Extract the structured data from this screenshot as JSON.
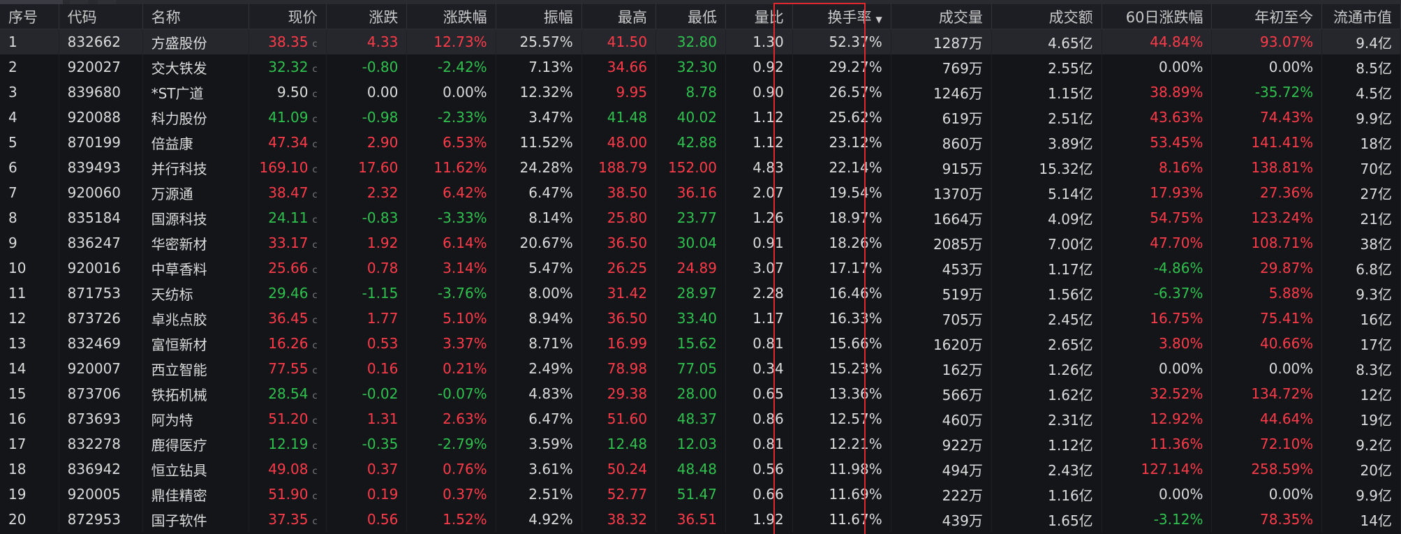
{
  "headers": {
    "seq": "序号",
    "code": "代码",
    "name": "名称",
    "price": "现价",
    "change": "涨跌",
    "pct": "涨跌幅",
    "amplitude": "振幅",
    "high": "最高",
    "low": "最低",
    "volratio": "量比",
    "turnover": "换手率",
    "volume": "成交量",
    "amount": "成交额",
    "d60": "60日涨跌幅",
    "ytd": "年初至今",
    "mcap": "流通市值"
  },
  "sort": {
    "column": "turnover",
    "direction": "desc"
  },
  "colors": {
    "up": "#ff3b4a",
    "down": "#2fc24f",
    "flat": "#dcdcdc",
    "highlight": "#e0292f"
  },
  "rows": [
    {
      "seq": "1",
      "code": "832662",
      "name": "方盛股份",
      "price": "38.35",
      "change": "4.33",
      "pct": "12.73%",
      "amplitude": "25.57%",
      "high": "41.50",
      "low": "32.80",
      "volratio": "1.30",
      "turnover": "52.37%",
      "volume": "1287万",
      "amount": "4.65亿",
      "d60": "44.84%",
      "ytd": "93.07%",
      "mcap": "9.4亿",
      "c": {
        "price": "red",
        "change": "red",
        "pct": "red",
        "high": "red",
        "low": "green",
        "d60": "red",
        "ytd": "red"
      }
    },
    {
      "seq": "2",
      "code": "920027",
      "name": "交大铁发",
      "price": "32.32",
      "change": "-0.80",
      "pct": "-2.42%",
      "amplitude": "7.13%",
      "high": "34.66",
      "low": "32.30",
      "volratio": "0.92",
      "turnover": "29.27%",
      "volume": "769万",
      "amount": "2.55亿",
      "d60": "0.00%",
      "ytd": "0.00%",
      "mcap": "8.5亿",
      "c": {
        "price": "green",
        "change": "green",
        "pct": "green",
        "high": "red",
        "low": "green",
        "d60": "white",
        "ytd": "white"
      }
    },
    {
      "seq": "3",
      "code": "839680",
      "name": "*ST广道",
      "price": "9.50",
      "change": "0.00",
      "pct": "0.00%",
      "amplitude": "12.32%",
      "high": "9.95",
      "low": "8.78",
      "volratio": "0.90",
      "turnover": "26.57%",
      "volume": "1246万",
      "amount": "1.15亿",
      "d60": "38.89%",
      "ytd": "-35.72%",
      "mcap": "4.5亿",
      "c": {
        "price": "white",
        "change": "white",
        "pct": "white",
        "high": "red",
        "low": "green",
        "d60": "red",
        "ytd": "green"
      }
    },
    {
      "seq": "4",
      "code": "920088",
      "name": "科力股份",
      "price": "41.09",
      "change": "-0.98",
      "pct": "-2.33%",
      "amplitude": "3.47%",
      "high": "41.48",
      "low": "40.02",
      "volratio": "1.12",
      "turnover": "25.62%",
      "volume": "619万",
      "amount": "2.51亿",
      "d60": "43.63%",
      "ytd": "74.43%",
      "mcap": "9.9亿",
      "c": {
        "price": "green",
        "change": "green",
        "pct": "green",
        "high": "green",
        "low": "green",
        "d60": "red",
        "ytd": "red"
      }
    },
    {
      "seq": "5",
      "code": "870199",
      "name": "倍益康",
      "price": "47.34",
      "change": "2.90",
      "pct": "6.53%",
      "amplitude": "11.52%",
      "high": "48.00",
      "low": "42.88",
      "volratio": "1.12",
      "turnover": "23.12%",
      "volume": "860万",
      "amount": "3.89亿",
      "d60": "53.45%",
      "ytd": "141.41%",
      "mcap": "18亿",
      "c": {
        "price": "red",
        "change": "red",
        "pct": "red",
        "high": "red",
        "low": "green",
        "d60": "red",
        "ytd": "red"
      }
    },
    {
      "seq": "6",
      "code": "839493",
      "name": "并行科技",
      "price": "169.10",
      "change": "17.60",
      "pct": "11.62%",
      "amplitude": "24.28%",
      "high": "188.79",
      "low": "152.00",
      "volratio": "4.83",
      "turnover": "22.14%",
      "volume": "915万",
      "amount": "15.32亿",
      "d60": "8.16%",
      "ytd": "138.81%",
      "mcap": "70亿",
      "c": {
        "price": "red",
        "change": "red",
        "pct": "red",
        "high": "red",
        "low": "red",
        "d60": "red",
        "ytd": "red"
      }
    },
    {
      "seq": "7",
      "code": "920060",
      "name": "万源通",
      "price": "38.47",
      "change": "2.32",
      "pct": "6.42%",
      "amplitude": "6.47%",
      "high": "38.50",
      "low": "36.16",
      "volratio": "2.07",
      "turnover": "19.54%",
      "volume": "1370万",
      "amount": "5.14亿",
      "d60": "17.93%",
      "ytd": "27.36%",
      "mcap": "27亿",
      "c": {
        "price": "red",
        "change": "red",
        "pct": "red",
        "high": "red",
        "low": "red",
        "d60": "red",
        "ytd": "red"
      }
    },
    {
      "seq": "8",
      "code": "835184",
      "name": "国源科技",
      "price": "24.11",
      "change": "-0.83",
      "pct": "-3.33%",
      "amplitude": "8.14%",
      "high": "25.80",
      "low": "23.77",
      "volratio": "1.26",
      "turnover": "18.97%",
      "volume": "1664万",
      "amount": "4.09亿",
      "d60": "54.75%",
      "ytd": "123.24%",
      "mcap": "21亿",
      "c": {
        "price": "green",
        "change": "green",
        "pct": "green",
        "high": "red",
        "low": "green",
        "d60": "red",
        "ytd": "red"
      }
    },
    {
      "seq": "9",
      "code": "836247",
      "name": "华密新材",
      "price": "33.17",
      "change": "1.92",
      "pct": "6.14%",
      "amplitude": "20.67%",
      "high": "36.50",
      "low": "30.04",
      "volratio": "0.91",
      "turnover": "18.26%",
      "volume": "2085万",
      "amount": "7.00亿",
      "d60": "47.70%",
      "ytd": "108.71%",
      "mcap": "38亿",
      "c": {
        "price": "red",
        "change": "red",
        "pct": "red",
        "high": "red",
        "low": "green",
        "d60": "red",
        "ytd": "red"
      }
    },
    {
      "seq": "10",
      "code": "920016",
      "name": "中草香料",
      "price": "25.66",
      "change": "0.78",
      "pct": "3.14%",
      "amplitude": "5.47%",
      "high": "26.25",
      "low": "24.89",
      "volratio": "3.07",
      "turnover": "17.17%",
      "volume": "453万",
      "amount": "1.17亿",
      "d60": "-4.86%",
      "ytd": "29.87%",
      "mcap": "6.8亿",
      "c": {
        "price": "red",
        "change": "red",
        "pct": "red",
        "high": "red",
        "low": "red",
        "d60": "green",
        "ytd": "red"
      }
    },
    {
      "seq": "11",
      "code": "871753",
      "name": "天纺标",
      "price": "29.46",
      "change": "-1.15",
      "pct": "-3.76%",
      "amplitude": "8.00%",
      "high": "31.42",
      "low": "28.97",
      "volratio": "2.28",
      "turnover": "16.46%",
      "volume": "519万",
      "amount": "1.56亿",
      "d60": "-6.37%",
      "ytd": "5.88%",
      "mcap": "9.3亿",
      "c": {
        "price": "green",
        "change": "green",
        "pct": "green",
        "high": "red",
        "low": "green",
        "d60": "green",
        "ytd": "red"
      }
    },
    {
      "seq": "12",
      "code": "873726",
      "name": "卓兆点胶",
      "price": "36.45",
      "change": "1.77",
      "pct": "5.10%",
      "amplitude": "8.94%",
      "high": "36.50",
      "low": "33.40",
      "volratio": "1.17",
      "turnover": "16.33%",
      "volume": "705万",
      "amount": "2.45亿",
      "d60": "16.75%",
      "ytd": "75.41%",
      "mcap": "16亿",
      "c": {
        "price": "red",
        "change": "red",
        "pct": "red",
        "high": "red",
        "low": "green",
        "d60": "red",
        "ytd": "red"
      }
    },
    {
      "seq": "13",
      "code": "832469",
      "name": "富恒新材",
      "price": "16.26",
      "change": "0.53",
      "pct": "3.37%",
      "amplitude": "8.71%",
      "high": "16.99",
      "low": "15.62",
      "volratio": "0.81",
      "turnover": "15.66%",
      "volume": "1620万",
      "amount": "2.65亿",
      "d60": "3.80%",
      "ytd": "40.66%",
      "mcap": "17亿",
      "c": {
        "price": "red",
        "change": "red",
        "pct": "red",
        "high": "red",
        "low": "green",
        "d60": "red",
        "ytd": "red"
      }
    },
    {
      "seq": "14",
      "code": "920007",
      "name": "西立智能",
      "price": "77.55",
      "change": "0.16",
      "pct": "0.21%",
      "amplitude": "2.49%",
      "high": "78.98",
      "low": "77.05",
      "volratio": "0.34",
      "turnover": "15.23%",
      "volume": "162万",
      "amount": "1.26亿",
      "d60": "0.00%",
      "ytd": "0.00%",
      "mcap": "8.3亿",
      "c": {
        "price": "red",
        "change": "red",
        "pct": "red",
        "high": "red",
        "low": "green",
        "d60": "white",
        "ytd": "white"
      }
    },
    {
      "seq": "15",
      "code": "873706",
      "name": "铁拓机械",
      "price": "28.54",
      "change": "-0.02",
      "pct": "-0.07%",
      "amplitude": "4.83%",
      "high": "29.38",
      "low": "28.00",
      "volratio": "0.65",
      "turnover": "13.36%",
      "volume": "566万",
      "amount": "1.62亿",
      "d60": "32.52%",
      "ytd": "134.72%",
      "mcap": "12亿",
      "c": {
        "price": "green",
        "change": "green",
        "pct": "green",
        "high": "red",
        "low": "green",
        "d60": "red",
        "ytd": "red"
      }
    },
    {
      "seq": "16",
      "code": "873693",
      "name": "阿为特",
      "price": "51.20",
      "change": "1.31",
      "pct": "2.63%",
      "amplitude": "6.47%",
      "high": "51.60",
      "low": "48.37",
      "volratio": "0.86",
      "turnover": "12.57%",
      "volume": "460万",
      "amount": "2.31亿",
      "d60": "12.92%",
      "ytd": "44.64%",
      "mcap": "19亿",
      "c": {
        "price": "red",
        "change": "red",
        "pct": "red",
        "high": "red",
        "low": "green",
        "d60": "red",
        "ytd": "red"
      }
    },
    {
      "seq": "17",
      "code": "832278",
      "name": "鹿得医疗",
      "price": "12.19",
      "change": "-0.35",
      "pct": "-2.79%",
      "amplitude": "3.59%",
      "high": "12.48",
      "low": "12.03",
      "volratio": "0.81",
      "turnover": "12.21%",
      "volume": "922万",
      "amount": "1.12亿",
      "d60": "11.36%",
      "ytd": "72.10%",
      "mcap": "9.2亿",
      "c": {
        "price": "green",
        "change": "green",
        "pct": "green",
        "high": "green",
        "low": "green",
        "d60": "red",
        "ytd": "red"
      }
    },
    {
      "seq": "18",
      "code": "836942",
      "name": "恒立钻具",
      "price": "49.08",
      "change": "0.37",
      "pct": "0.76%",
      "amplitude": "3.61%",
      "high": "50.24",
      "low": "48.48",
      "volratio": "0.56",
      "turnover": "11.98%",
      "volume": "494万",
      "amount": "2.43亿",
      "d60": "127.14%",
      "ytd": "258.59%",
      "mcap": "20亿",
      "c": {
        "price": "red",
        "change": "red",
        "pct": "red",
        "high": "red",
        "low": "green",
        "d60": "red",
        "ytd": "red"
      }
    },
    {
      "seq": "19",
      "code": "920005",
      "name": "鼎佳精密",
      "price": "51.90",
      "change": "0.19",
      "pct": "0.37%",
      "amplitude": "2.51%",
      "high": "52.77",
      "low": "51.47",
      "volratio": "0.66",
      "turnover": "11.69%",
      "volume": "222万",
      "amount": "1.16亿",
      "d60": "0.00%",
      "ytd": "0.00%",
      "mcap": "9.9亿",
      "c": {
        "price": "red",
        "change": "red",
        "pct": "red",
        "high": "red",
        "low": "green",
        "d60": "white",
        "ytd": "white"
      }
    },
    {
      "seq": "20",
      "code": "872953",
      "name": "国子软件",
      "price": "37.35",
      "change": "0.56",
      "pct": "1.52%",
      "amplitude": "4.92%",
      "high": "38.32",
      "low": "36.51",
      "volratio": "1.92",
      "turnover": "11.67%",
      "volume": "439万",
      "amount": "1.65亿",
      "d60": "-3.12%",
      "ytd": "78.35%",
      "mcap": "14亿",
      "c": {
        "price": "red",
        "change": "red",
        "pct": "red",
        "high": "red",
        "low": "red",
        "d60": "green",
        "ytd": "red"
      }
    }
  ],
  "price_suffix": "c"
}
